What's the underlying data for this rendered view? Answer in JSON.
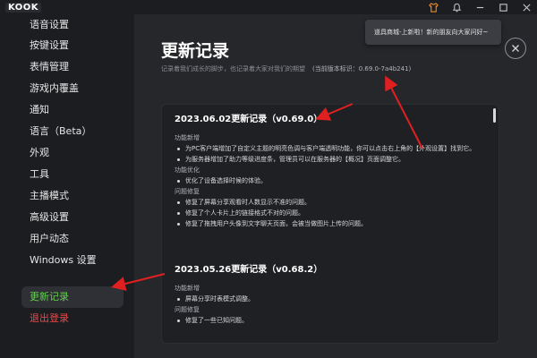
{
  "app": {
    "logo_text": "KOOK"
  },
  "toast": {
    "text": "道具商城-上新啦！新的朋友向大家问好~"
  },
  "sidebar": {
    "items": [
      {
        "label": "语音设置",
        "state": "normal"
      },
      {
        "label": "按键设置",
        "state": "normal"
      },
      {
        "label": "表情管理",
        "state": "normal"
      },
      {
        "label": "游戏内覆盖",
        "state": "normal"
      },
      {
        "label": "通知",
        "state": "normal"
      },
      {
        "label": "语言（Beta）",
        "state": "normal"
      },
      {
        "label": "外观",
        "state": "normal"
      },
      {
        "label": "工具",
        "state": "normal"
      },
      {
        "label": "主播模式",
        "state": "normal"
      },
      {
        "label": "高级设置",
        "state": "normal"
      },
      {
        "label": "用户动态",
        "state": "normal"
      },
      {
        "label": "Windows 设置",
        "state": "normal"
      },
      {
        "label": "更新记录",
        "state": "active"
      },
      {
        "label": "退出登录",
        "state": "danger"
      }
    ]
  },
  "main": {
    "title": "更新记录",
    "subtitle": "记录着我们成长的脚步，也记录着大家对我们的期望",
    "version_label": "(当前版本标识：0.69.0-7a4b241)"
  },
  "changelog": [
    {
      "title": "2023.06.02更新记录（v0.69.0）",
      "sections": [
        {
          "heading": "功能新增",
          "items": [
            "为PC客户端增加了自定义主题的明亮色调与客户端透明功能，你可以点击右上角的【外观设置】找到它。",
            "为服务器增加了助力等级进度条，管理员可以在服务器的【概况】页面调整它。"
          ]
        },
        {
          "heading": "功能优化",
          "items": [
            "优化了设备选择时候的体验。"
          ]
        },
        {
          "heading": "问题修复",
          "items": [
            "修复了屏幕分享观看时人数显示不准的问题。",
            "修复了个人卡片上的链接格式不对的问题。",
            "修复了拖拽用户头像到文字聊天页面，会被当做图片上传的问题。"
          ]
        }
      ]
    },
    {
      "title": "2023.05.26更新记录（v0.68.2）",
      "sections": [
        {
          "heading": "功能新增",
          "items": [
            "屏幕分享时表模式调整。"
          ]
        },
        {
          "heading": "问题修复",
          "items": [
            "修复了一些已知问题。"
          ]
        }
      ]
    }
  ],
  "colors": {
    "accent_green": "#61d24d",
    "danger_red": "#f04848",
    "annotation_red": "#e02020"
  },
  "icons": {
    "titlebar": [
      "shirt-icon",
      "bell-icon",
      "minimize-icon",
      "maximize-icon",
      "close-icon"
    ]
  }
}
